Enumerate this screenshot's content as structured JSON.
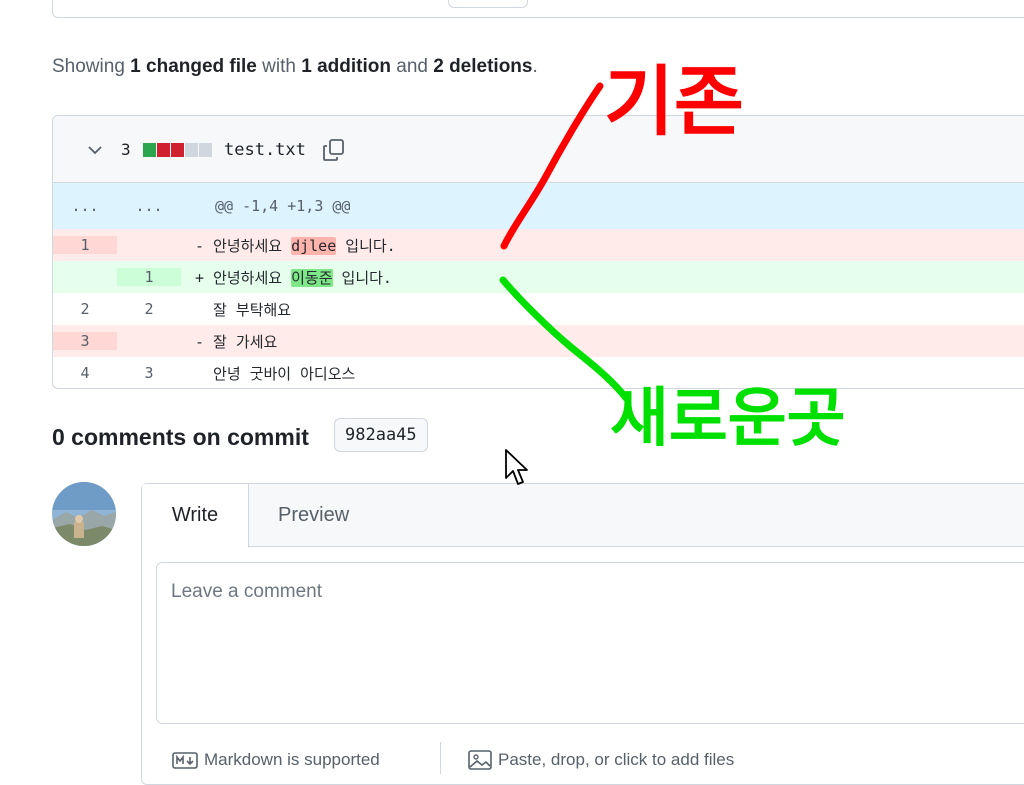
{
  "summary": {
    "prefix": "Showing ",
    "files": "1 changed file",
    "mid": " with ",
    "additions": "1 addition",
    "and": " and ",
    "deletions": "2 deletions",
    "suffix": "."
  },
  "file": {
    "change_count": "3",
    "name": "test.txt",
    "diffstat": [
      "#2da44e",
      "#cf222e",
      "#cf222e",
      "#d0d7de",
      "#d0d7de"
    ]
  },
  "diff": {
    "hunk": {
      "old": "...",
      "new": "...",
      "text": "@@ -1,4 +1,3 @@"
    },
    "rows": [
      {
        "type": "del",
        "old": "1",
        "new": "",
        "pre": "- 안녕하세요 ",
        "hl": "djlee",
        "post": " 입니다."
      },
      {
        "type": "add",
        "old": "",
        "new": "1",
        "pre": "+ 안녕하세요 ",
        "hl": "이동준",
        "post": " 입니다."
      },
      {
        "type": "ctx",
        "old": "2",
        "new": "2",
        "pre": "  잘 부탁해요",
        "hl": "",
        "post": ""
      },
      {
        "type": "del",
        "old": "3",
        "new": "",
        "pre": "- 잘 가세요",
        "hl": "",
        "post": ""
      },
      {
        "type": "ctx",
        "old": "4",
        "new": "3",
        "pre": "  안녕 굿바이 아디오스",
        "hl": "",
        "post": ""
      }
    ]
  },
  "comments": {
    "title": "0 comments on commit",
    "sha": "982aa45"
  },
  "editor": {
    "tab_write": "Write",
    "tab_preview": "Preview",
    "placeholder": "Leave a comment",
    "markdown_note": "Markdown is supported",
    "attach_note": "Paste, drop, or click to add files"
  },
  "annotations": {
    "old_label": "기존",
    "new_label": "새로운곳",
    "old_color": "#ff0000",
    "new_color": "#00e000"
  },
  "colors": {
    "hunk_bg": "#ddf4ff",
    "del_bg": "#ffebe9",
    "add_bg": "#e6ffec"
  }
}
